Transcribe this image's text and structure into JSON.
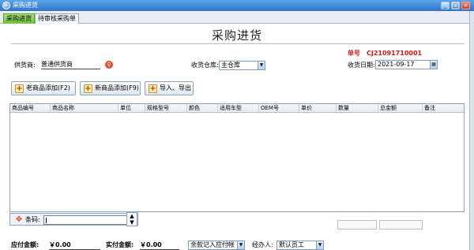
{
  "window": {
    "title": "采购进货",
    "min": "_",
    "max": "□",
    "close": "×"
  },
  "tabs": [
    {
      "label": "采购进货",
      "active": true
    },
    {
      "label": "待审核采购单",
      "active": false
    }
  ],
  "form": {
    "title": "采购进货",
    "order_no_label": "单号",
    "order_no": "CJ21091710001",
    "supplier_label": "供货商:",
    "supplier_value": "普通供货商",
    "warehouse_label": "收货仓库:",
    "warehouse_value": "主仓库",
    "date_label": "收货日期:",
    "date_value": "2021-09-17"
  },
  "toolbar": {
    "old_item": "老商品添加(F2)",
    "new_item": "新商品添加(F9)",
    "import_export": "导入、导出"
  },
  "grid": {
    "columns": [
      "商品编号",
      "商品名称",
      "单位",
      "规格型号",
      "颜色",
      "适用车型",
      "OEM号",
      "单价",
      "数量",
      "总金额",
      "备注"
    ],
    "rows": []
  },
  "barcode": {
    "label": "条码:",
    "value": ""
  },
  "footer": {
    "payable_label": "应付金额:",
    "payable_value": "￥0.00",
    "actual_label": "实付金额:",
    "actual_value": "￥0.00",
    "balance_mode": "余款记入应付帐",
    "handler_label": "经办人:",
    "handler_value": "默认员工"
  }
}
